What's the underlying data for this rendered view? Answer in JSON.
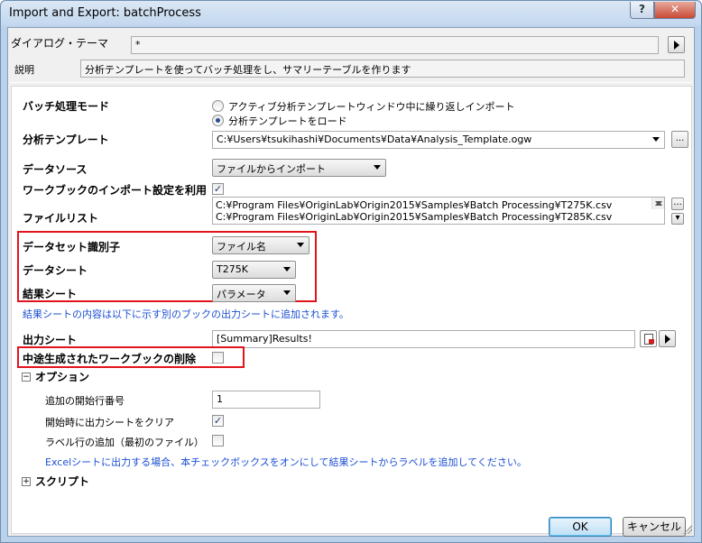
{
  "window": {
    "title": "Import and Export: batchProcess",
    "help_label": "?",
    "close_label": "✕"
  },
  "theme": {
    "label": "ダイアログ・テーマ",
    "value": "*"
  },
  "description": {
    "label": "説明",
    "text": "分析テンプレートを使ってバッチ処理をし、サマリーテーブルを作ります"
  },
  "batch_mode": {
    "label": "バッチ処理モード",
    "options": [
      "アクティブ分析テンプレートウィンドウ中に繰り返しインポート",
      "分析テンプレートをロード"
    ],
    "selected_index": 1
  },
  "template": {
    "label": "分析テンプレート",
    "value": "C:¥Users¥tsukihashi¥Documents¥Data¥Analysis_Template.ogw",
    "browse": "..."
  },
  "data_source": {
    "label": "データソース",
    "value": "ファイルからインポート"
  },
  "use_import": {
    "label": "ワークブックのインポート設定を利用",
    "checked": true
  },
  "file_list": {
    "label": "ファイルリスト",
    "files": [
      "C:¥Program Files¥OriginLab¥Origin2015¥Samples¥Batch Processing¥T275K.csv",
      "C:¥Program Files¥OriginLab¥Origin2015¥Samples¥Batch Processing¥T285K.csv"
    ],
    "browse": "..."
  },
  "dataset_id": {
    "label": "データセット識別子",
    "value": "ファイル名"
  },
  "data_sheet": {
    "label": "データシート",
    "value": "T275K"
  },
  "result_sheet": {
    "label": "結果シート",
    "value": "パラメータ"
  },
  "result_note": "結果シートの内容は以下に示す別のブックの出力シートに追加されます。",
  "output_sheet": {
    "label": "出力シート",
    "value": "[Summary]Results!"
  },
  "delete_intermediate": {
    "label": "中途生成されたワークブックの削除",
    "checked": false
  },
  "options": {
    "label": "オプション",
    "toggle": "−",
    "start_row": {
      "label": "追加の開始行番号",
      "value": "1"
    },
    "clear_output": {
      "label": "開始時に出力シートをクリア",
      "checked": true
    },
    "add_label": {
      "label": "ラベル行の追加（最初のファイル）",
      "checked": false
    },
    "excel_note": "Excelシートに出力する場合、本チェックボックスをオンにして結果シートからラベルを追加してください。"
  },
  "script": {
    "label": "スクリプト",
    "toggle": "+"
  },
  "buttons": {
    "ok": "OK",
    "cancel": "キャンセル"
  },
  "colors": {
    "highlight_red": "#e2141b",
    "note_blue": "#1c4fd2"
  }
}
